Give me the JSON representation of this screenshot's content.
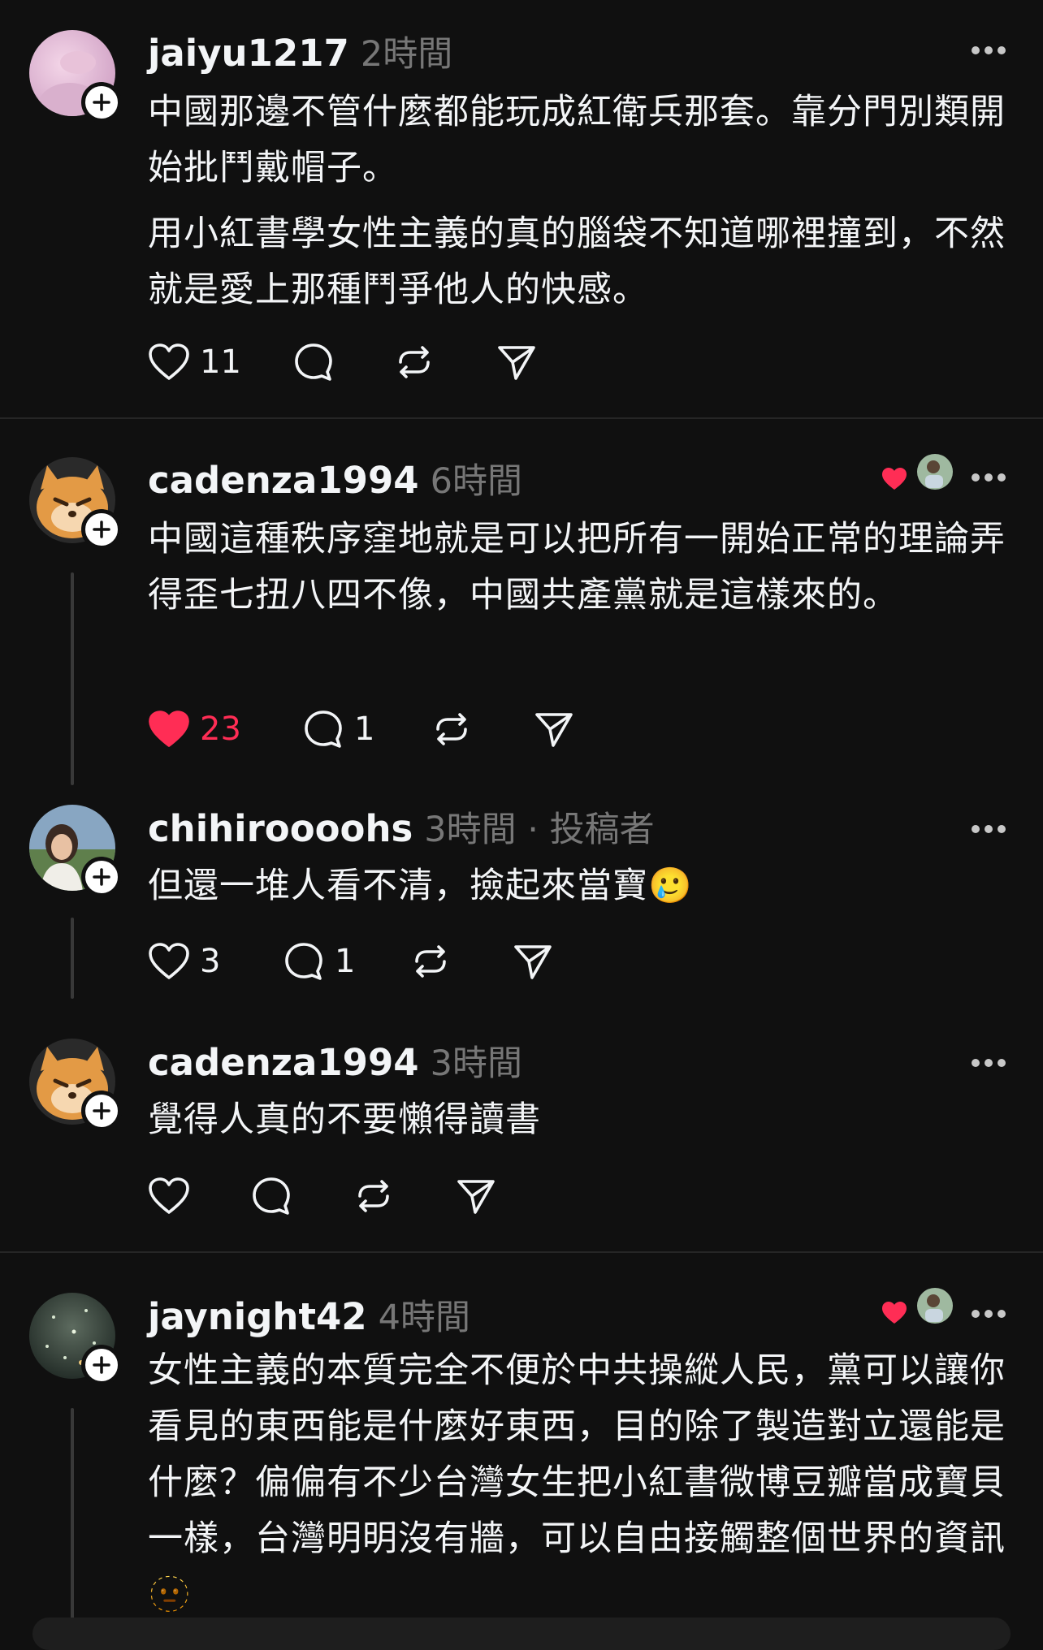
{
  "posts": [
    {
      "username": "jaiyu1217",
      "time": "2時間",
      "paragraphs": [
        "中國那邊不管什麼都能玩成紅衛兵那套。靠分門別類開始批鬥戴帽子。",
        "用小紅書學女性主義的真的腦袋不知道哪裡撞到，不然就是愛上那種鬥爭他人的快感。"
      ],
      "likes": "11",
      "replies": "",
      "liked": false
    },
    {
      "username": "cadenza1994",
      "time": "6時間",
      "paragraphs": [
        "中國這種秩序窪地就是可以把所有一開始正常的理論弄得歪七扭八四不像，中國共產黨就是這樣來的。"
      ],
      "likes": "23",
      "replies": "1",
      "liked": true
    },
    {
      "username": "chihiroooohs",
      "time": "3時間 · 投稿者",
      "paragraphs": [
        "但還一堆人看不清，撿起來當寶🥲"
      ],
      "likes": "3",
      "replies": "1",
      "liked": false
    },
    {
      "username": "cadenza1994",
      "time": "3時間",
      "paragraphs": [
        "覺得人真的不要懶得讀書"
      ],
      "likes": "",
      "replies": "",
      "liked": false
    },
    {
      "username": "jaynight42",
      "time": "4時間",
      "paragraphs": [
        "女性主義的本質完全不便於中共操縱人民，黨可以讓你看見的東西能是什麼好東西，目的除了製造對立還能是什麼？偏偏有不少台灣女生把小紅書微博豆瓣當成寶貝一樣，台灣明明沒有牆，可以自由接觸整個世界的資訊🫥"
      ],
      "likes": "",
      "replies": "",
      "liked": false
    }
  ],
  "colors": {
    "background": "#101010",
    "text": "#f3f5f7",
    "muted": "#777777",
    "like_active": "#ff2d55"
  },
  "icons": [
    "heart-icon",
    "comment-icon",
    "repost-icon",
    "share-icon",
    "more-icon",
    "follow-plus-icon"
  ]
}
